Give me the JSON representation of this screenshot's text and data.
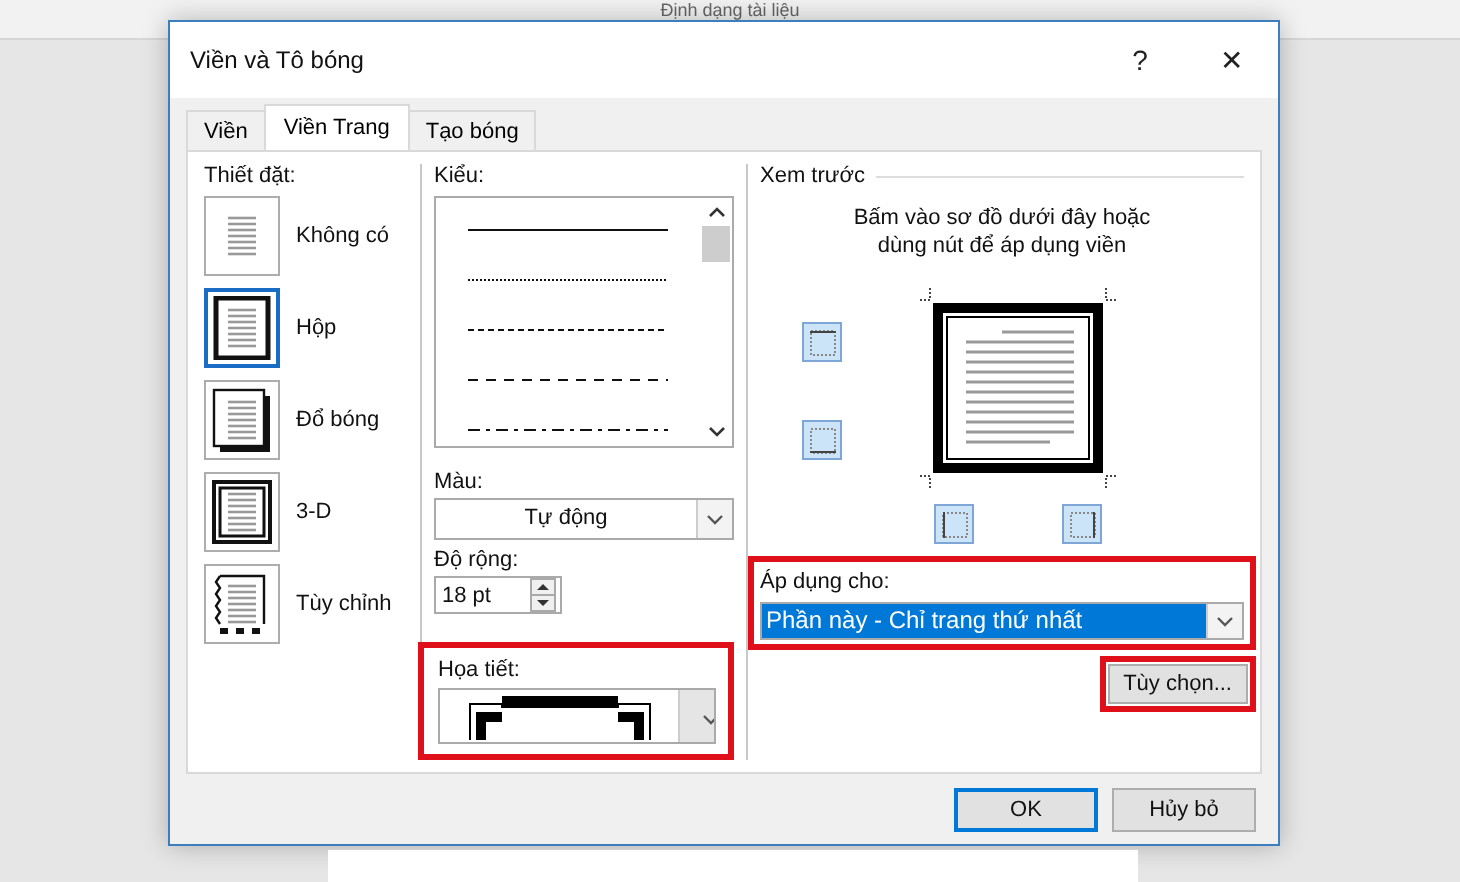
{
  "background": {
    "title": "Định dạng tài liệu"
  },
  "window": {
    "title": "Viền và Tô bóng",
    "help": "?",
    "close": "✕"
  },
  "tabs": [
    {
      "label": "Viền",
      "selected": false
    },
    {
      "label": "Viền Trang",
      "selected": true
    },
    {
      "label": "Tạo bóng",
      "selected": false
    }
  ],
  "setting": {
    "label": "Thiết đặt:",
    "items": [
      {
        "kind": "none",
        "label": "Không có",
        "selected": false
      },
      {
        "kind": "box",
        "label": "Hộp",
        "selected": true
      },
      {
        "kind": "shadow",
        "label": "Đổ bóng",
        "selected": false
      },
      {
        "kind": "threed",
        "label": "3-D",
        "selected": false
      },
      {
        "kind": "custom",
        "label": "Tùy chỉnh",
        "selected": false
      }
    ]
  },
  "style": {
    "label": "Kiểu:",
    "lines": [
      {
        "kind": "solid",
        "selected": false
      },
      {
        "kind": "dotted",
        "selected": false
      },
      {
        "kind": "dashed",
        "selected": false
      },
      {
        "kind": "long-dashed",
        "selected": false
      },
      {
        "kind": "dash-dot",
        "selected": false
      }
    ]
  },
  "color": {
    "label": "Màu:",
    "value": "Tự động"
  },
  "width": {
    "label": "Độ rộng:",
    "value": "18 pt"
  },
  "art": {
    "label": "Họa tiết:",
    "highlighted": true
  },
  "preview": {
    "label": "Xem trước",
    "hint": "Bấm vào sơ đồ dưới đây hoặc dùng nút để áp dụng viền"
  },
  "apply_to": {
    "label": "Áp dụng cho:",
    "value": "Phần này - Chỉ trang thứ nhất",
    "highlighted": true
  },
  "options_button": {
    "label": "Tùy chọn...",
    "highlighted": true
  },
  "buttons": [
    {
      "label": "OK",
      "default": true
    },
    {
      "label": "Hủy bỏ",
      "default": false
    }
  ]
}
